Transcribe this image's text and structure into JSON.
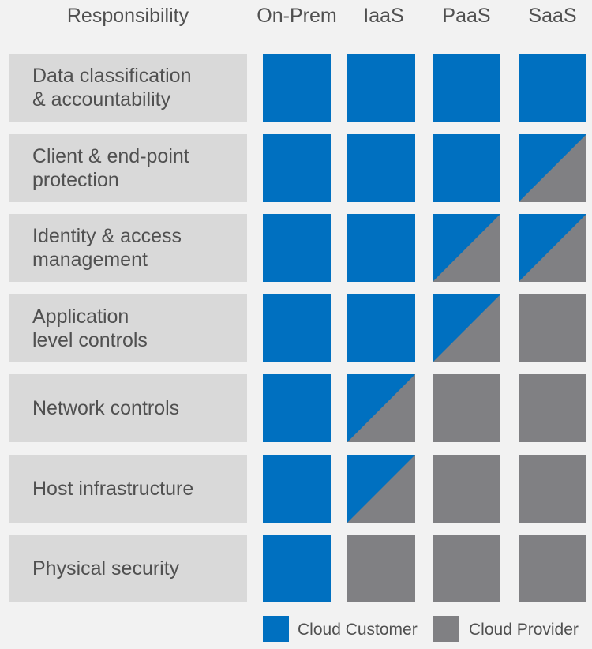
{
  "colors": {
    "customer": "#0070c0",
    "provider": "#808083",
    "label_bg": "#d9d9d9",
    "background": "#f2f2f2"
  },
  "header": {
    "responsibility": "Responsibility",
    "columns": [
      "On-Prem",
      "IaaS",
      "PaaS",
      "SaaS"
    ]
  },
  "rows": [
    {
      "label": "Data classification\n& accountability",
      "cells": [
        "customer",
        "customer",
        "customer",
        "customer"
      ]
    },
    {
      "label": "Client & end-point\nprotection",
      "cells": [
        "customer",
        "customer",
        "customer",
        "shared"
      ]
    },
    {
      "label": "Identity & access\nmanagement",
      "cells": [
        "customer",
        "customer",
        "shared",
        "shared"
      ]
    },
    {
      "label": "Application\nlevel controls",
      "cells": [
        "customer",
        "customer",
        "shared",
        "provider"
      ]
    },
    {
      "label": "Network controls",
      "cells": [
        "customer",
        "shared",
        "provider",
        "provider"
      ]
    },
    {
      "label": "Host infrastructure",
      "cells": [
        "customer",
        "shared",
        "provider",
        "provider"
      ]
    },
    {
      "label": "Physical security",
      "cells": [
        "customer",
        "provider",
        "provider",
        "provider"
      ]
    }
  ],
  "legend": {
    "customer_label": "Cloud Customer",
    "provider_label": "Cloud Provider"
  }
}
